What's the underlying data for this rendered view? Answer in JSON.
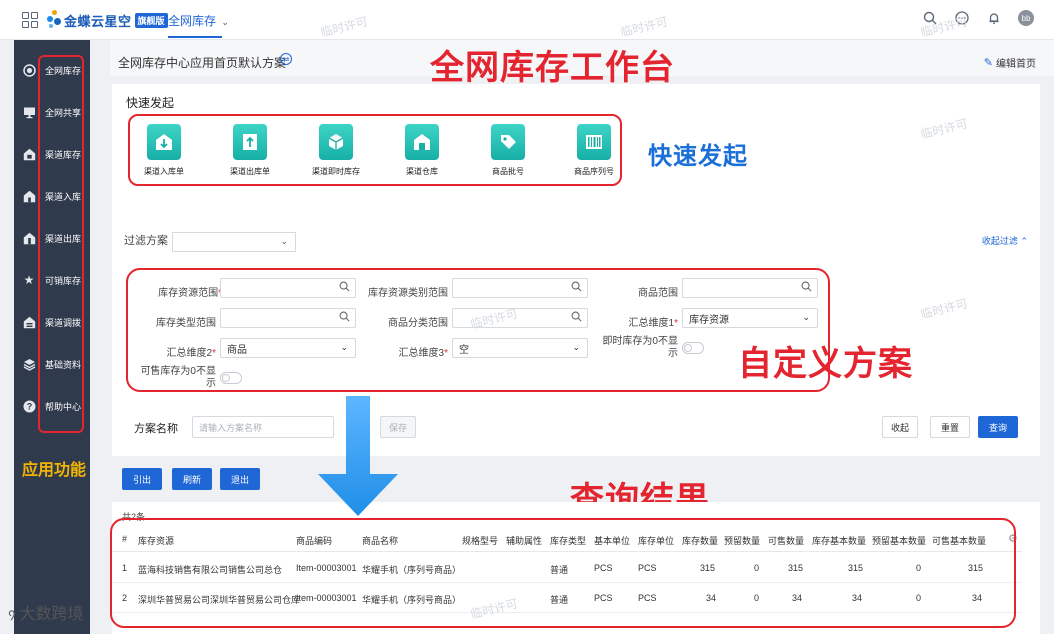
{
  "topbar": {
    "logo_text": "金蝶云星空",
    "logo_badge": "旗舰版",
    "nav_tab": "全网库存",
    "avatar_text": "bb"
  },
  "sidebar": {
    "items": [
      {
        "label": "全网库存",
        "icon": "circle-target-icon"
      },
      {
        "label": "全网共享",
        "icon": "monitor-icon"
      },
      {
        "label": "渠道库存",
        "icon": "home-box-icon"
      },
      {
        "label": "渠道入库",
        "icon": "home-in-icon"
      },
      {
        "label": "渠道出库",
        "icon": "home-out-icon"
      },
      {
        "label": "可销库存",
        "icon": "star-icon"
      },
      {
        "label": "渠道调拨",
        "icon": "home-transfer-icon"
      },
      {
        "label": "基础资料",
        "icon": "layers-icon"
      },
      {
        "label": "帮助中心",
        "icon": "help-icon"
      }
    ],
    "caption": "应用功能"
  },
  "header": {
    "title": "全网库存中心应用首页默认方案",
    "edit_home": "编辑首页",
    "annotation": "全网库存工作台"
  },
  "quick": {
    "title": "快速发起",
    "annotation": "快速发起",
    "items": [
      {
        "label": "渠道入库单",
        "icon": "inbound-icon"
      },
      {
        "label": "渠道出库单",
        "icon": "outbound-icon"
      },
      {
        "label": "渠道即时库存",
        "icon": "cube-icon"
      },
      {
        "label": "渠道仓库",
        "icon": "warehouse-icon"
      },
      {
        "label": "商品批号",
        "icon": "tag-icon"
      },
      {
        "label": "商品序列号",
        "icon": "barcode-icon"
      }
    ]
  },
  "filter": {
    "label": "过滤方案",
    "collapse": "收起过滤",
    "annotation": "自定义方案",
    "fields": {
      "stock_scope": "库存资源范围",
      "stock_cat_scope": "库存资源类别范围",
      "product_scope": "商品范围",
      "stock_type_scope": "库存类型范围",
      "product_cat_scope": "商品分类范围",
      "dim1_label": "汇总维度1",
      "dim1_value": "库存资源",
      "dim2_label": "汇总维度2",
      "dim2_value": "商品",
      "dim3_label": "汇总维度3",
      "dim3_value": "空",
      "realtime_zero": "即时库存为0不显示",
      "sellable_zero": "可售库存为0不显示"
    },
    "scheme_label": "方案名称",
    "scheme_placeholder": "请输入方案名称",
    "save": "保存",
    "collapse_btn": "收起",
    "reset_btn": "重置",
    "query_btn": "查询"
  },
  "actions": {
    "export": "引出",
    "refresh": "刷新",
    "exit": "退出"
  },
  "results": {
    "annotation": "查询结果",
    "count": "共2条",
    "columns": [
      "#",
      "库存资源",
      "商品编码",
      "商品名称",
      "规格型号",
      "辅助属性",
      "库存类型",
      "基本单位",
      "库存单位",
      "库存数量",
      "预留数量",
      "可售数量",
      "库存基本数量",
      "预留基本数量",
      "可售基本数量"
    ],
    "rows": [
      [
        "1",
        "蓝海科技销售有限公司销售公司总仓",
        "Item-00003001",
        "华耀手机（序列号商品）",
        "",
        "",
        "普通",
        "PCS",
        "PCS",
        "315",
        "0",
        "315",
        "315",
        "0",
        "315"
      ],
      [
        "2",
        "深圳华普贸易公司深圳华普贸易公司仓库",
        "Item-00003001",
        "华耀手机（序列号商品）",
        "",
        "",
        "普通",
        "PCS",
        "PCS",
        "34",
        "0",
        "34",
        "34",
        "0",
        "34"
      ]
    ]
  },
  "watermark": {
    "brand": "大数跨境",
    "tile_text": "临时许可"
  }
}
